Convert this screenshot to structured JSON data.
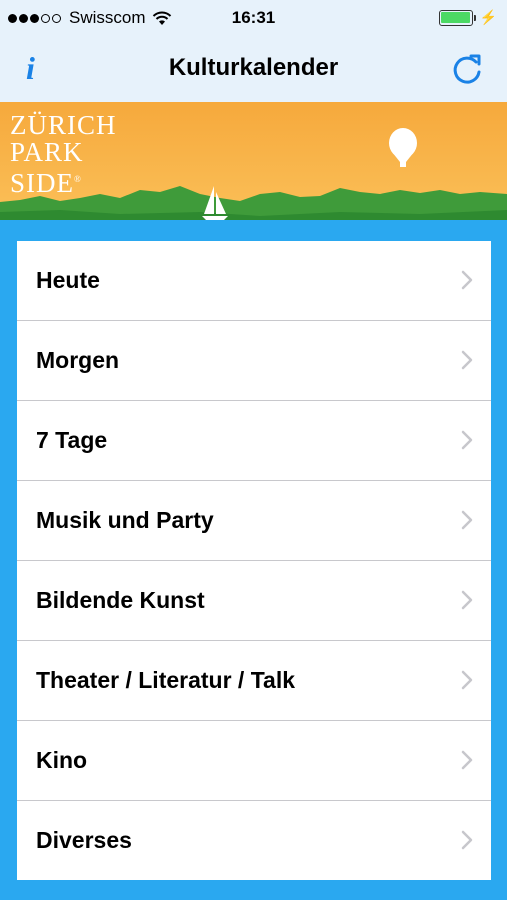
{
  "status_bar": {
    "carrier": "Swisscom",
    "time": "16:31"
  },
  "nav": {
    "title": "Kulturkalender",
    "info_icon": "i"
  },
  "banner": {
    "logo_lines": [
      "ZÜRICH",
      "PARK",
      "SIDE"
    ],
    "trademark": "®"
  },
  "list": {
    "items": [
      {
        "label": "Heute"
      },
      {
        "label": "Morgen"
      },
      {
        "label": "7 Tage"
      },
      {
        "label": "Musik und Party"
      },
      {
        "label": "Bildende Kunst"
      },
      {
        "label": "Theater / Literatur / Talk"
      },
      {
        "label": "Kino"
      },
      {
        "label": "Diverses"
      }
    ]
  },
  "colors": {
    "accent": "#1a82e6",
    "banner_orange": "#f8b24a",
    "hills": "#3f9b3a",
    "water": "#2aa8f0",
    "battery": "#4cd964"
  }
}
